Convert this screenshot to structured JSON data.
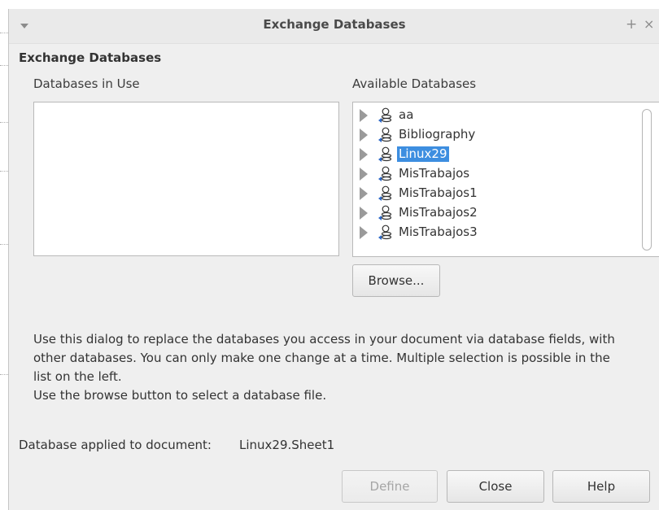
{
  "window": {
    "title": "Exchange Databases",
    "controls": [
      "+",
      "×"
    ]
  },
  "heading": "Exchange Databases",
  "databases_in_use": {
    "label": "Databases in Use",
    "items": []
  },
  "available_databases": {
    "label": "Available Databases",
    "items": [
      {
        "label": "aa",
        "selected": false,
        "icon": "database-icon"
      },
      {
        "label": "Bibliography",
        "selected": false,
        "icon": "database-icon"
      },
      {
        "label": "Linux29",
        "selected": true,
        "icon": "database-icon"
      },
      {
        "label": "MisTrabajos",
        "selected": false,
        "icon": "database-icon"
      },
      {
        "label": "MisTrabajos1",
        "selected": false,
        "icon": "database-icon"
      },
      {
        "label": "MisTrabajos2",
        "selected": false,
        "icon": "database-icon"
      },
      {
        "label": "MisTrabajos3",
        "selected": false,
        "icon": "database-icon"
      }
    ]
  },
  "browse_label": "Browse...",
  "description_lines": [
    "Use this dialog to replace the databases you access in your document via database fields, with",
    "other databases. You can only make one change at a time. Multiple selection is possible in the",
    "list on the left.",
    "Use the browse button to select a database file."
  ],
  "applied": {
    "label": "Database applied to document:",
    "value": "Linux29.Sheet1"
  },
  "buttons": {
    "define": "Define",
    "close": "Close",
    "help": "Help"
  },
  "colors": {
    "selection": "#3d8ee0",
    "dialog_bg": "#efefef"
  }
}
